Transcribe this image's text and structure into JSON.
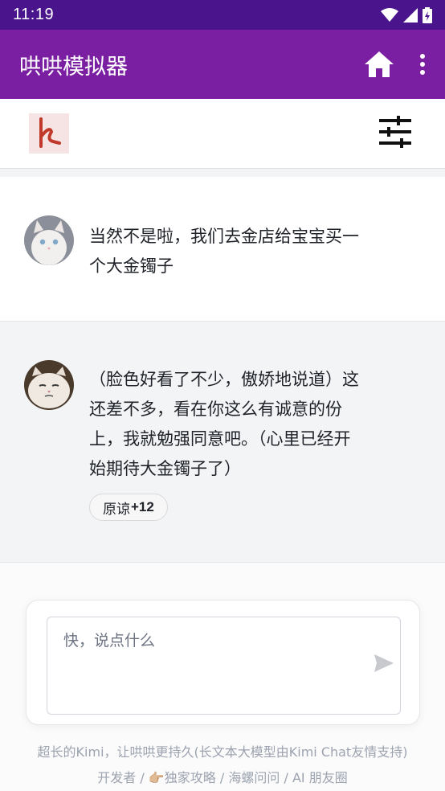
{
  "status_bar": {
    "time": "11:19"
  },
  "app_bar": {
    "title": "哄哄模拟器",
    "home_icon": "home-icon",
    "menu_icon": "more-vertical-icon"
  },
  "toolbar": {
    "logo_icon": "heel-logo-icon",
    "settings_icon": "sliders-icon"
  },
  "messages": [
    {
      "role": "user",
      "avatar": "white-cat-avatar",
      "text_lines": [
        "当然不是啦，我们去金店给宝宝买一",
        "个大金镯子"
      ]
    },
    {
      "role": "girlfriend",
      "avatar": "grumpy-cat-avatar",
      "text_lines": [
        "（脸色好看了不少，傲娇地说道）这",
        "还差不多，看在你这么有诚意的份",
        "上，我就勉强同意吧。（心里已经开",
        "始期待大金镯子了）"
      ],
      "badge": {
        "label": "原谅",
        "count": "+12"
      }
    }
  ],
  "input": {
    "placeholder": "快，说点什么",
    "send_icon": "send-icon"
  },
  "footer": {
    "line1": "超长的Kimi，让哄哄更持久(长文本大模型由Kimi Chat友情支持)",
    "links": [
      "开发者",
      "👉🏼独家攻略",
      "海螺问问",
      "AI 朋友圈"
    ],
    "separator": " / "
  },
  "colors": {
    "status_bar": "#4a148c",
    "app_bar": "#7b1fa2"
  }
}
